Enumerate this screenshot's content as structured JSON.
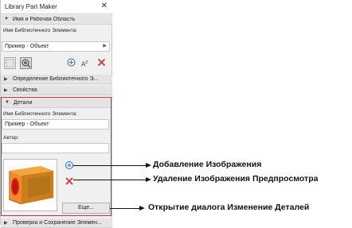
{
  "panel": {
    "title": "Library Part Maker",
    "sections": {
      "name_area": "Имя и Рабочая Область",
      "definition": "Определение Библиотечного Э...",
      "properties": "Свойства",
      "details": "Детали",
      "check_save": "Проверка и Сохранение Элемен..."
    },
    "lib_name_label": "Имя Библиотечного Элемента:",
    "lib_name_value": "Пример - Объект",
    "details_name_label": "Имя Библиотечного Элемента:",
    "details_name_value": "Пример - Объект",
    "author_label": "Автор:",
    "author_value": "",
    "more_button": "Еще..."
  },
  "callouts": {
    "add_image": "Добавление Изображения",
    "remove_preview": "Удаление Изображения Предпросмотра",
    "open_details": "Открытие диалога Изменение Деталей"
  },
  "colors": {
    "highlight_red": "#e3262d",
    "icon_blue": "#2a6fd6",
    "delete_red": "#e3262d"
  }
}
